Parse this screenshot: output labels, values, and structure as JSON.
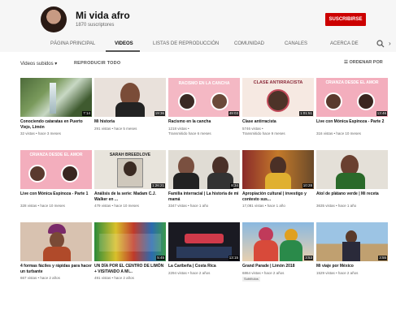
{
  "channel": {
    "name": "Mi vida afro",
    "subscribers": "1870 suscriptores",
    "subscribe_label": "SUSCRIBIRSE"
  },
  "tabs": [
    "PÁGINA PRINCIPAL",
    "VIDEOS",
    "LISTAS DE REPRODUCCIÓN",
    "COMUNIDAD",
    "CANALES",
    "ACERCA DE"
  ],
  "toolbar": {
    "uploads_label": "Videos subidos",
    "play_all": "REPRODUCIR TODO",
    "sort_label": "ORDENAR POR"
  },
  "videos": [
    {
      "title": "Conociendo cataratas en Puerto Viejo, Limón",
      "meta": "32 vistas • hace 3 meses",
      "meta2": "",
      "duration": "7:14",
      "thumb_text": ""
    },
    {
      "title": "Mi historia",
      "meta": "291 vistas • hace 5 meses",
      "meta2": "",
      "duration": "19:36",
      "thumb_text": ""
    },
    {
      "title": "Racismo en la cancha",
      "meta": "1218 vistas •",
      "meta2": "Transmitido hace 6 meses",
      "duration": "49:03",
      "thumb_text": "RACISMO EN LA CANCHA"
    },
    {
      "title": "Clase antirracista",
      "meta": "5746 vistas •",
      "meta2": "Transmitido hace 9 meses",
      "duration": "1:01:51",
      "thumb_text": "CLASE ANTIRRACISTA"
    },
    {
      "title": "Live con Mónica Espinoza - Parte 2",
      "meta": "316 vistas • hace 10 meses",
      "meta2": "",
      "duration": "13:46",
      "thumb_text": "CRIANZA DESDE EL AMOR"
    },
    {
      "title": "Live con Mónica Espinoza - Parte 1",
      "meta": "328 vistas • hace 10 meses",
      "meta2": "",
      "duration": "",
      "thumb_text": "CRIANZA DESDE EL AMOR"
    },
    {
      "title": "Análisis de la serie: Madam C.J. Walker en ...",
      "meta": "479 vistas • hace 10 meses",
      "meta2": "",
      "duration": "1:26:21",
      "thumb_text": "SARAH BREEDLOVE"
    },
    {
      "title": "Familia interracial | La historia de mi mamá",
      "meta": "3347 vistas • hace 1 año",
      "meta2": "",
      "duration": "8:34",
      "thumb_text": ""
    },
    {
      "title": "Apropiación cultural | investigo y contesto sus...",
      "meta": "17,081 vistas • hace 1 año",
      "meta2": "",
      "duration": "10:28",
      "thumb_text": ""
    },
    {
      "title": "Atol de plátano verde | Mi receta",
      "meta": "3635 vistas • hace 1 año",
      "meta2": "",
      "duration": "",
      "thumb_text": ""
    },
    {
      "title": "4 formas fáciles y rápidas para hacer un turbante",
      "meta": "667 vistas • hace 2 años",
      "meta2": "",
      "duration": "",
      "thumb_text": ""
    },
    {
      "title": "UN DÍA POR EL CENTRO DE LIMÓN + VISITANDO A MI...",
      "meta": "491 vistas • hace 2 años",
      "meta2": "",
      "duration": "5:45",
      "thumb_text": ""
    },
    {
      "title": "La Caribeña | Costa Rica",
      "meta": "2294 vistas • hace 2 años",
      "meta2": "",
      "duration": "13:15",
      "thumb_text": ""
    },
    {
      "title": "Grand Parade | Limón 2018",
      "meta": "6864 vistas • hace 2 años",
      "meta2": "",
      "duration": "3:53",
      "thumb_text": "",
      "badge": "Subtítulos"
    },
    {
      "title": "Mi viaje por México",
      "meta": "1529 vistas • hace 2 años",
      "meta2": "",
      "duration": "3:55",
      "thumb_text": ""
    }
  ]
}
